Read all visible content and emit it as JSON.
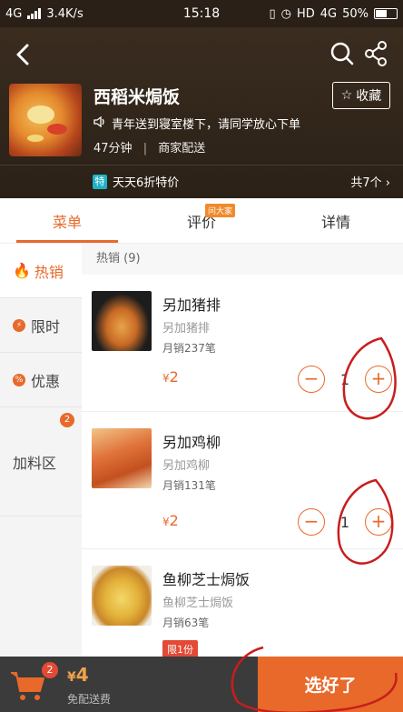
{
  "statusbar": {
    "network": "4G",
    "speed": "3.4K/s",
    "time": "15:18",
    "hd": "HD",
    "net2": "4G",
    "battery": "50%"
  },
  "header": {
    "shop_name": "西稻米焗饭",
    "favorite_label": "收藏",
    "notice": "青年送到寝室楼下，请同学放心下单",
    "delivery_time": "47分钟",
    "delivery_type": "商家配送",
    "promo_tag": "特",
    "promo_text": "天天6折特价",
    "promo_count": "共7个"
  },
  "tabs": [
    {
      "label": "菜单",
      "active": true
    },
    {
      "label": "评价",
      "badge": "问大家"
    },
    {
      "label": "详情"
    }
  ],
  "sidebar": {
    "items": [
      {
        "label": "热销",
        "icon": "flame-icon"
      },
      {
        "label": "限时",
        "icon": "lightning-icon",
        "icon_text": "⚡"
      },
      {
        "label": "优惠",
        "icon": "percent-icon",
        "icon_text": "%"
      },
      {
        "label": "加料区",
        "badge": "2"
      }
    ]
  },
  "content": {
    "section_title": "热销 (9)",
    "items": [
      {
        "name": "另加猪排",
        "desc": "另加猪排",
        "sales": "月销237笔",
        "price": "2",
        "yen": "¥",
        "qty": "1"
      },
      {
        "name": "另加鸡柳",
        "desc": "另加鸡柳",
        "sales": "月销131笔",
        "price": "2",
        "yen": "¥",
        "qty": "1"
      },
      {
        "name": "鱼柳芝士焗饭",
        "desc": "鱼柳芝士焗饭",
        "sales": "月销63笔",
        "limit": "限1份"
      }
    ]
  },
  "bottom": {
    "cart_badge": "2",
    "total_yen": "¥",
    "total": "4",
    "freeship": "免配送费",
    "checkout": "选好了"
  },
  "colors": {
    "accent": "#e8692a",
    "header_bg": "#2b2117",
    "bottom_bg": "#3b3b3b"
  }
}
